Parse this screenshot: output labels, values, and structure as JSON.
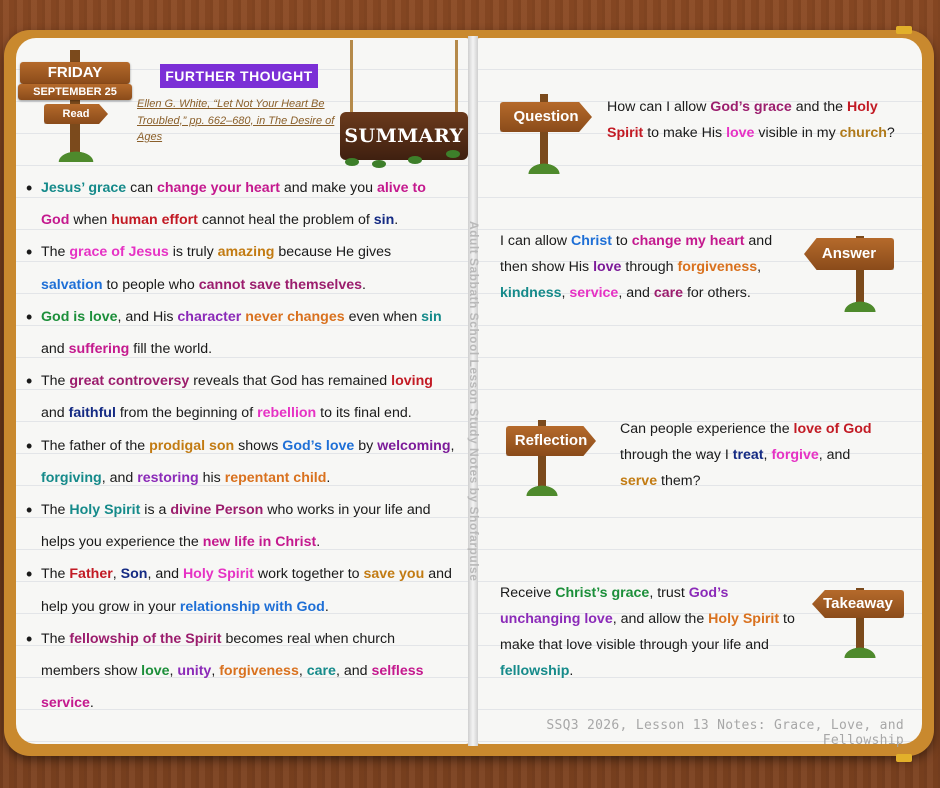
{
  "header": {
    "day": "FRIDAY",
    "date": "SEPTEMBER 25",
    "read": "Read",
    "section": "FURTHER THOUGHT",
    "citation": "Ellen G. White, “Let Not Your Heart Be Troubled,” pp. 662–680, in The Desire of Ages",
    "summary": "SUMMARY"
  },
  "spine_text": "Adult Sabbath School Lesson Study Notes by Shofarpulse",
  "bullets": [
    [
      [
        "Jesus’ grace",
        "c-teal"
      ],
      [
        " can ",
        ""
      ],
      [
        "change your heart",
        "c-mag"
      ],
      [
        " and make you ",
        ""
      ],
      [
        "alive to God",
        "c-mag"
      ],
      [
        " when ",
        ""
      ],
      [
        "human effort",
        "c-red"
      ],
      [
        " cannot heal the problem of ",
        ""
      ],
      [
        "sin",
        "c-navy"
      ],
      [
        ".",
        ""
      ]
    ],
    [
      [
        "The ",
        ""
      ],
      [
        "grace of Jesus",
        "c-pink"
      ],
      [
        " is truly ",
        ""
      ],
      [
        "amazing",
        "c-gold"
      ],
      [
        " because He gives ",
        ""
      ],
      [
        "salvation",
        "c-blue"
      ],
      [
        " to people who ",
        ""
      ],
      [
        "cannot save themselves",
        "c-plum"
      ],
      [
        ".",
        ""
      ]
    ],
    [
      [
        "God is love",
        "c-green"
      ],
      [
        ", and His ",
        ""
      ],
      [
        "character",
        "c-violet"
      ],
      [
        " ",
        ""
      ],
      [
        "never changes",
        "c-orange"
      ],
      [
        " even when ",
        ""
      ],
      [
        "sin",
        "c-teal"
      ],
      [
        " and ",
        ""
      ],
      [
        "suffering",
        "c-mag"
      ],
      [
        " fill the world.",
        ""
      ]
    ],
    [
      [
        "The ",
        ""
      ],
      [
        "great controversy",
        "c-plum"
      ],
      [
        " reveals that God has remained ",
        ""
      ],
      [
        "loving",
        "c-red"
      ],
      [
        " and ",
        ""
      ],
      [
        "faithful",
        "c-navy"
      ],
      [
        " from the beginning of ",
        ""
      ],
      [
        "rebellion",
        "c-pink"
      ],
      [
        " to its final end.",
        ""
      ]
    ],
    [
      [
        "The father of the ",
        ""
      ],
      [
        "prodigal son",
        "c-gold"
      ],
      [
        " shows ",
        ""
      ],
      [
        "God’s love",
        "c-blue"
      ],
      [
        " by ",
        ""
      ],
      [
        "welcoming",
        "c-purple"
      ],
      [
        ", ",
        ""
      ],
      [
        "forgiving",
        "c-teal"
      ],
      [
        ", and ",
        ""
      ],
      [
        "restoring",
        "c-violet"
      ],
      [
        " his ",
        ""
      ],
      [
        "repentant child",
        "c-orange"
      ],
      [
        ".",
        ""
      ]
    ],
    [
      [
        "The ",
        ""
      ],
      [
        "Holy Spirit",
        "c-teal"
      ],
      [
        " is a ",
        ""
      ],
      [
        "divine Person",
        "c-plum"
      ],
      [
        " who works in your life and helps you experience the ",
        ""
      ],
      [
        "new life in Christ",
        "c-mag"
      ],
      [
        ".",
        ""
      ]
    ],
    [
      [
        "The ",
        ""
      ],
      [
        "Father",
        "c-red"
      ],
      [
        ", ",
        ""
      ],
      [
        "Son",
        "c-navy"
      ],
      [
        ", and ",
        ""
      ],
      [
        "Holy Spirit",
        "c-pink"
      ],
      [
        " work together to ",
        ""
      ],
      [
        "save you",
        "c-gold"
      ],
      [
        " and help you grow in your ",
        ""
      ],
      [
        "relationship with God",
        "c-blue"
      ],
      [
        ".",
        ""
      ]
    ],
    [
      [
        "The ",
        ""
      ],
      [
        "fellowship of the Spirit",
        "c-plum"
      ],
      [
        " becomes real when church members show ",
        ""
      ],
      [
        "love",
        "c-green"
      ],
      [
        ", ",
        ""
      ],
      [
        "unity",
        "c-violet"
      ],
      [
        ", ",
        ""
      ],
      [
        "forgiveness",
        "c-orange"
      ],
      [
        ", ",
        ""
      ],
      [
        "care",
        "c-teal"
      ],
      [
        ", and ",
        ""
      ],
      [
        "selfless service",
        "c-mag"
      ],
      [
        ".",
        ""
      ]
    ]
  ],
  "cards": {
    "question": {
      "label": "Question",
      "text": [
        [
          "How can I allow ",
          ""
        ],
        [
          "God’s grace",
          "c-plum"
        ],
        [
          " and the ",
          ""
        ],
        [
          "Holy Spirit",
          "c-red"
        ],
        [
          " to make His ",
          ""
        ],
        [
          "love",
          "c-pink"
        ],
        [
          " visible in my ",
          ""
        ],
        [
          "church",
          "c-tan"
        ],
        [
          "?",
          ""
        ]
      ]
    },
    "answer": {
      "label": "Answer",
      "text": [
        [
          "I can allow ",
          ""
        ],
        [
          "Christ",
          "c-blue"
        ],
        [
          " to ",
          ""
        ],
        [
          "change my heart",
          "c-mag"
        ],
        [
          " and then show His ",
          ""
        ],
        [
          "love",
          "c-purple"
        ],
        [
          " through ",
          ""
        ],
        [
          "forgiveness",
          "c-orange"
        ],
        [
          ", ",
          ""
        ],
        [
          "kindness",
          "c-teal"
        ],
        [
          ", ",
          ""
        ],
        [
          "service",
          "c-pink"
        ],
        [
          ", and ",
          ""
        ],
        [
          "care",
          "c-plum"
        ],
        [
          " for others.",
          ""
        ]
      ]
    },
    "reflection": {
      "label": "Reflection",
      "text": [
        [
          "Can people experience the ",
          ""
        ],
        [
          "love of God",
          "c-red"
        ],
        [
          " through the way I ",
          ""
        ],
        [
          "treat",
          "c-navy"
        ],
        [
          ", ",
          ""
        ],
        [
          "forgive",
          "c-pink"
        ],
        [
          ", and ",
          ""
        ],
        [
          "serve",
          "c-gold"
        ],
        [
          " them?",
          ""
        ]
      ]
    },
    "takeaway": {
      "label": "Takeaway",
      "text": [
        [
          "Receive ",
          ""
        ],
        [
          "Christ’s grace",
          "c-green"
        ],
        [
          ", trust ",
          ""
        ],
        [
          "God’s unchanging love",
          "c-violet"
        ],
        [
          ", and allow the ",
          ""
        ],
        [
          "Holy Spirit",
          "c-orange"
        ],
        [
          " to make that love visible through your life and ",
          ""
        ],
        [
          "fellowship",
          "c-teal"
        ],
        [
          ".",
          ""
        ]
      ]
    }
  },
  "footer": "SSQ3 2026, Lesson 13 Notes: Grace, Love, and Fellowship",
  "colors": {
    "cover": "#c9892e",
    "page": "#f7f7f5",
    "badge": "#7b2fd6",
    "sign": "#a35f27"
  }
}
